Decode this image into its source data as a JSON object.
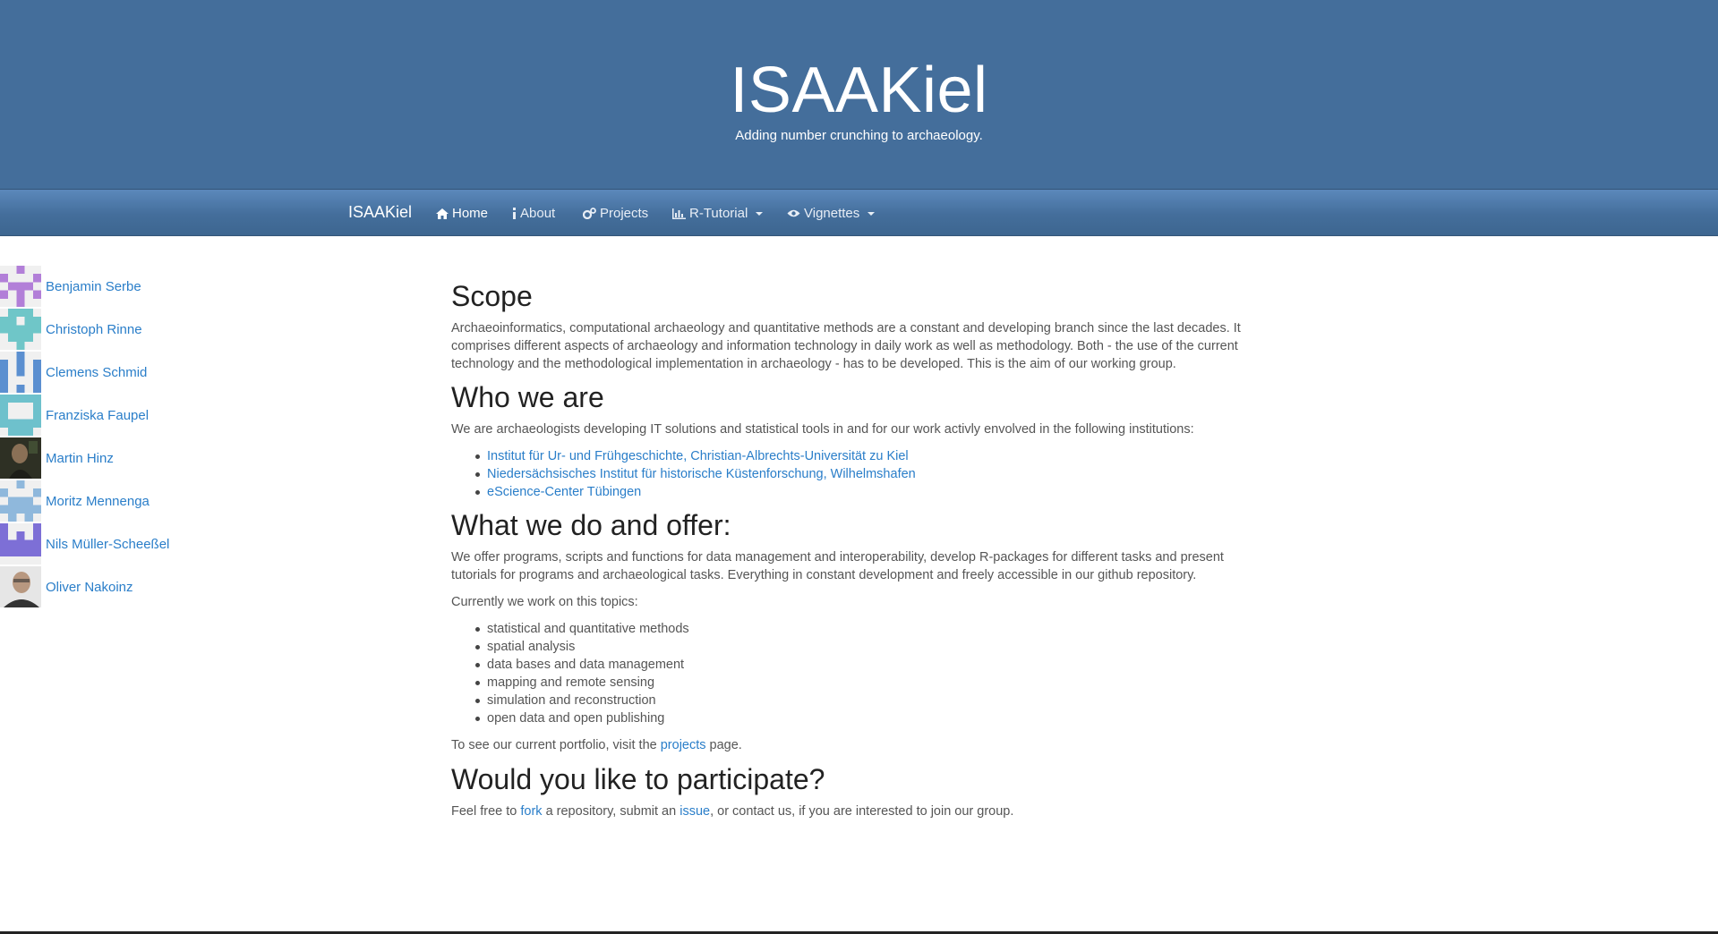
{
  "site": {
    "title": "ISAAKiel",
    "subtitle": "Adding number crunching to archaeology."
  },
  "navbar": {
    "brand": "ISAAKiel",
    "items": [
      {
        "label": "Home",
        "icon": "home-icon"
      },
      {
        "label": "About",
        "icon": "info-icon"
      },
      {
        "label": "Projects",
        "icon": "gears-icon"
      },
      {
        "label": "R-Tutorial",
        "icon": "bar-chart-icon"
      },
      {
        "label": "Vignettes",
        "icon": "eye-icon"
      }
    ]
  },
  "people": [
    {
      "name": "Benjamin Serbe",
      "avatar_color": "#b27fd8"
    },
    {
      "name": "Christoph Rinne",
      "avatar_color": "#6fc6c8"
    },
    {
      "name": "Clemens Schmid",
      "avatar_color": "#5b8fd0"
    },
    {
      "name": "Franziska Faupel",
      "avatar_color": "#6ec1cc"
    },
    {
      "name": "Martin Hinz",
      "avatar_color": "#3a3a30"
    },
    {
      "name": "Moritz Mennenga",
      "avatar_color": "#8fb8dc"
    },
    {
      "name": "Nils Müller-Scheeßel",
      "avatar_color": "#7d6fd6"
    },
    {
      "name": "Oliver Nakoinz",
      "avatar_color": "#555555"
    }
  ],
  "content": {
    "scope_heading": "Scope",
    "scope_text": "Archaeoinformatics, computational archaeology and quantitative methods are a constant and developing branch since the last decades. It comprises different aspects of archaeology and information technology in daily work as well as methodology. Both - the use of the current technology and the methodological implementation in archaeology - has to be developed. This is the aim of our working group.",
    "who_heading": "Who we are",
    "who_text": "We are archaeologists developing IT solutions and statistical tools in and for our work activly envolved in the following institutions:",
    "institutions": [
      "Institut für Ur- und Frühgeschichte, Christian-Albrechts-Universität zu Kiel",
      "Niedersächsisches Institut für historische Küstenforschung, Wilhelmshafen",
      "eScience-Center Tübingen"
    ],
    "what_heading": "What we do and offer:",
    "what_text": "We offer programs, scripts and functions for data management and interoperability, develop R-packages for different tasks and present tutorials for programs and archaeological tasks. Everything in constant development and freely accessible in our github repository.",
    "topics_intro": "Currently we work on this topics:",
    "topics": [
      "statistical and quantitative methods",
      "spatial analysis",
      "data bases and data management",
      "mapping and remote sensing",
      "simulation and reconstruction",
      "open data and open publishing"
    ],
    "portfolio_pre": "To see our current portfolio, visit the ",
    "portfolio_link": "projects",
    "portfolio_post": " page.",
    "participate_heading": "Would you like to participate?",
    "participate_pre": "Feel free to ",
    "fork_link": "fork",
    "participate_mid": " a repository, submit an ",
    "issue_link": "issue",
    "participate_post": ", or contact us, if you are interested to join our group."
  }
}
